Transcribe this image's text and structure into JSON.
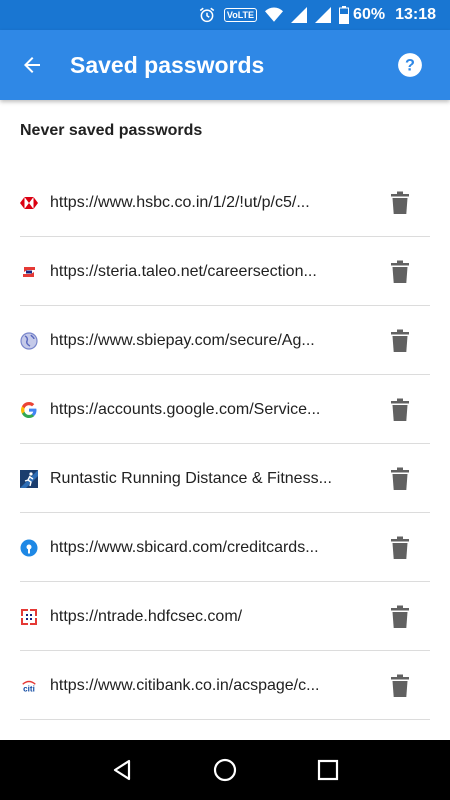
{
  "status_bar": {
    "volte": "VoLTE",
    "battery": "60%",
    "time": "13:18"
  },
  "app_bar": {
    "title": "Saved passwords",
    "back_icon": "arrow-back-icon",
    "help_icon": "help-icon"
  },
  "section": {
    "title": "Never saved passwords"
  },
  "entries": [
    {
      "url": "https://www.hsbc.co.in/1/2/!ut/p/c5/...",
      "icon": "hsbc-favicon",
      "color": "#db0011"
    },
    {
      "url": "https://steria.taleo.net/careersection...",
      "icon": "taleo-favicon",
      "color": "#e53935"
    },
    {
      "url": "https://www.sbiepay.com/secure/Ag...",
      "icon": "globe-favicon",
      "color": "#7f8ac9"
    },
    {
      "url": "https://accounts.google.com/Service...",
      "icon": "google-favicon",
      "color": "#4285f4"
    },
    {
      "url": "Runtastic Running Distance & Fitness...",
      "icon": "runtastic-favicon",
      "color": "#1a3d6e"
    },
    {
      "url": "https://www.sbicard.com/creditcards...",
      "icon": "sbicard-favicon",
      "color": "#1e88e5"
    },
    {
      "url": "https://ntrade.hdfcsec.com/",
      "icon": "hdfc-favicon",
      "color": "#e53935"
    },
    {
      "url": "https://www.citibank.co.in/acspage/c...",
      "icon": "citi-favicon",
      "color": "#0d47a1"
    }
  ],
  "nav_bar": {
    "back": "nav-back-icon",
    "home": "nav-home-icon",
    "recents": "nav-recents-icon"
  },
  "colors": {
    "status_bar": "#1976d2",
    "app_bar": "#2f88e6",
    "text": "#212121",
    "delete_icon": "#616161"
  }
}
